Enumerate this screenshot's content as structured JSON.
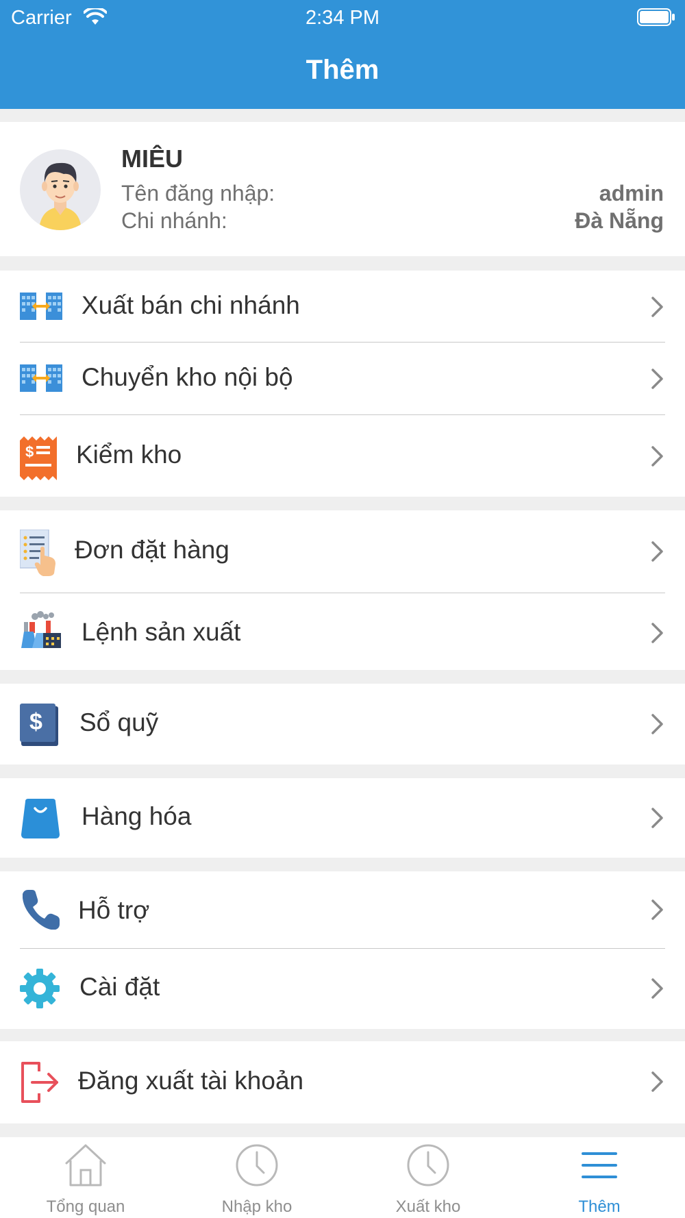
{
  "status_bar": {
    "carrier": "Carrier",
    "time": "2:34 PM"
  },
  "nav": {
    "title": "Thêm"
  },
  "profile": {
    "name": "MIÊU",
    "username_label": "Tên đăng nhập:",
    "username": "admin",
    "branch_label": "Chi nhánh:",
    "branch": "Đà Nẵng"
  },
  "menu": {
    "branch_sale": "Xuất bán chi nhánh",
    "internal_transfer": "Chuyển kho nội bộ",
    "stock_check": "Kiểm kho",
    "orders": "Đơn đặt hàng",
    "production_order": "Lệnh sản xuất",
    "cashbook": "Sổ quỹ",
    "goods": "Hàng hóa",
    "support": "Hỗ trợ",
    "settings": "Cài đặt",
    "logout": "Đăng xuất tài khoản"
  },
  "tabs": [
    {
      "label": "Tổng quan",
      "icon": "home-icon"
    },
    {
      "label": "Nhập kho",
      "icon": "clock-icon"
    },
    {
      "label": "Xuất kho",
      "icon": "clock-icon"
    },
    {
      "label": "Thêm",
      "icon": "menu-icon"
    }
  ],
  "colors": {
    "header": "#3193d8",
    "tab_active": "#2f8fd6",
    "tab_inactive": "#8e8e8e",
    "logout_red": "#e8505b"
  }
}
